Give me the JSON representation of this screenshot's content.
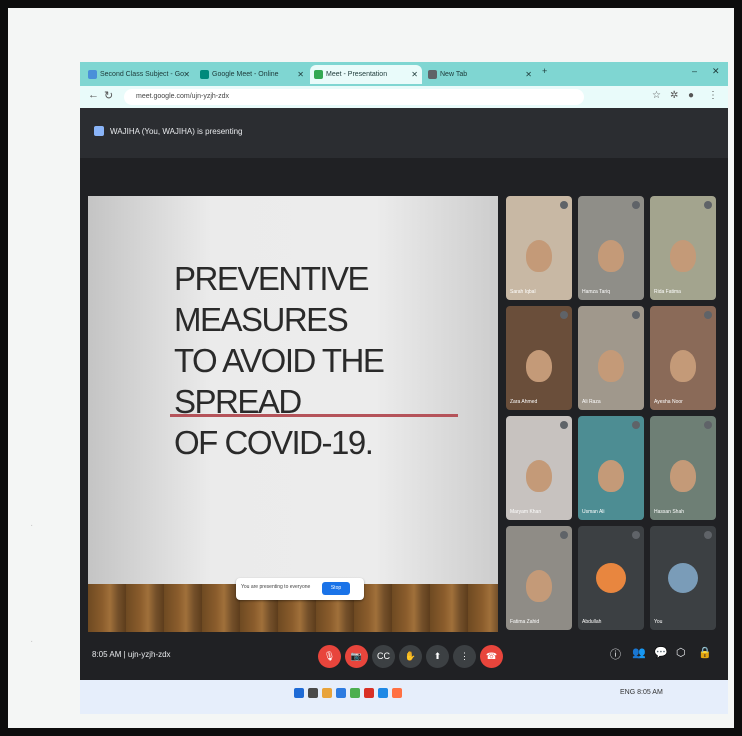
{
  "browser": {
    "tabs": [
      {
        "label": "Second Class Subject - Go",
        "fav": "#4a90d9",
        "active": false
      },
      {
        "label": "Google Meet - Online",
        "fav": "#00897b",
        "active": false
      },
      {
        "label": "Meet - Presentation",
        "fav": "#34a853",
        "active": true
      },
      {
        "label": "New Tab",
        "fav": "#5f6368",
        "active": false
      }
    ],
    "address": "meet.google.com/ujn-yzjh-zdx",
    "new_tab_glyph": "+",
    "min_glyph": "–",
    "close_glyph": "✕"
  },
  "meet": {
    "presenting_label": "WAJIHA (You, WAJIHA) is presenting",
    "meeting_info": "8:05 AM  |  ujn-yzjh-zdx"
  },
  "slide": {
    "title_lines": [
      "PREVENTIVE MEASURES",
      "TO AVOID THE SPREAD",
      "OF COVID-19."
    ],
    "accent_color": "#b5535a"
  },
  "stop_bar": {
    "text": "You are presenting to everyone",
    "button_label": "Stop"
  },
  "participants": [
    {
      "name": "Sarah Iqbal",
      "bg": "#c8b8a4",
      "kind": "video"
    },
    {
      "name": "Hamza Tariq",
      "bg": "#8f8e88",
      "kind": "video"
    },
    {
      "name": "Rida Fatima",
      "bg": "#a3a48e",
      "kind": "video"
    },
    {
      "name": "Zara Ahmed",
      "bg": "#6a4e3a",
      "kind": "video"
    },
    {
      "name": "Ali Raza",
      "bg": "#a0988c",
      "kind": "video"
    },
    {
      "name": "Ayesha Noor",
      "bg": "#8a6a58",
      "kind": "video"
    },
    {
      "name": "Maryam Khan",
      "bg": "#c7c2bf",
      "kind": "video"
    },
    {
      "name": "Usman Ali",
      "bg": "#4d8d93",
      "kind": "video"
    },
    {
      "name": "Hassan Shah",
      "bg": "#6e7f75",
      "kind": "video"
    },
    {
      "name": "Fatima Zahid",
      "bg": "#8f8c86",
      "kind": "video"
    },
    {
      "name": "Abdullah",
      "bg": "#3c4043",
      "kind": "avatar",
      "avatar_color": "#e8863f"
    },
    {
      "name": "You",
      "bg": "#3c4043",
      "kind": "avatar",
      "avatar_color": "#7a9cb8"
    }
  ],
  "controls": {
    "items": [
      {
        "name": "mic-off",
        "glyph": "🎙",
        "red": true
      },
      {
        "name": "camera-off",
        "glyph": "📷",
        "red": true
      },
      {
        "name": "captions",
        "glyph": "CC",
        "red": false
      },
      {
        "name": "raise-hand",
        "glyph": "✋",
        "red": false
      },
      {
        "name": "present",
        "glyph": "⬆",
        "red": false
      },
      {
        "name": "more",
        "glyph": "⋮",
        "red": false
      },
      {
        "name": "leave-call",
        "glyph": "☎",
        "red": true
      }
    ],
    "right_items": [
      {
        "name": "info",
        "glyph": "ⓘ"
      },
      {
        "name": "people",
        "glyph": "👥"
      },
      {
        "name": "chat",
        "glyph": "💬"
      },
      {
        "name": "activities",
        "glyph": "⬡"
      },
      {
        "name": "lock",
        "glyph": "🔒"
      }
    ]
  },
  "taskbar": {
    "icons": [
      "#1f6bd6",
      "#4a4a4a",
      "#e8a33a",
      "#2d7be0",
      "#4caf50",
      "#d93025",
      "#1e88e5",
      "#ff7043"
    ],
    "tray_text": "ENG  8:05 AM"
  }
}
